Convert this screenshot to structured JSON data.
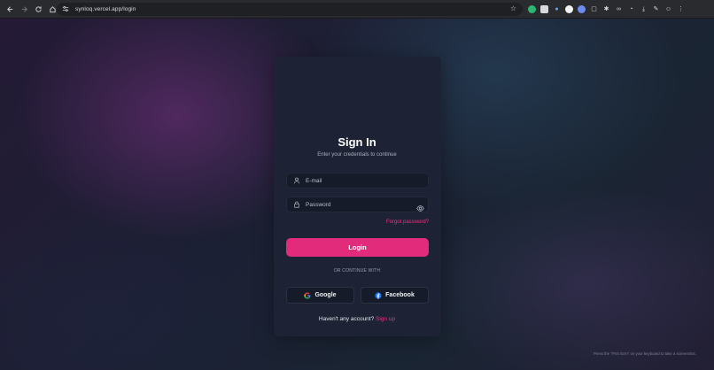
{
  "browser": {
    "url": "synloq.vercel.app/login",
    "nav_icons": [
      "back-icon",
      "forward-icon",
      "reload-icon",
      "home-icon"
    ],
    "extensions": [
      "extension-icon-1",
      "extension-icon-2",
      "extension-icon-3",
      "extension-icon-4",
      "extension-icon-5",
      "puzzle-icon",
      "extension-icon-6",
      "extension-icon-7",
      "extension-icon-8",
      "download-icon",
      "extension-icon-9",
      "profile-icon",
      "menu-icon"
    ]
  },
  "login": {
    "title": "Sign In",
    "subtitle": "Enter your credentials to continue",
    "email_placeholder": "E-mail",
    "password_placeholder": "Password",
    "forgot_label": "Forgot password?",
    "login_label": "Login",
    "divider_label": "OR CONTINUE WITH",
    "google_label": "Google",
    "facebook_label": "Facebook",
    "no_account_text": "Haven't any account? ",
    "signup_label": "Sign up"
  },
  "hint": {
    "text": "Press the \"Prnt Scrn\" on your keyboard to take a screenshot."
  },
  "colors": {
    "accent": "#e22b7a",
    "card": "#1d2334",
    "field": "#161b29"
  }
}
